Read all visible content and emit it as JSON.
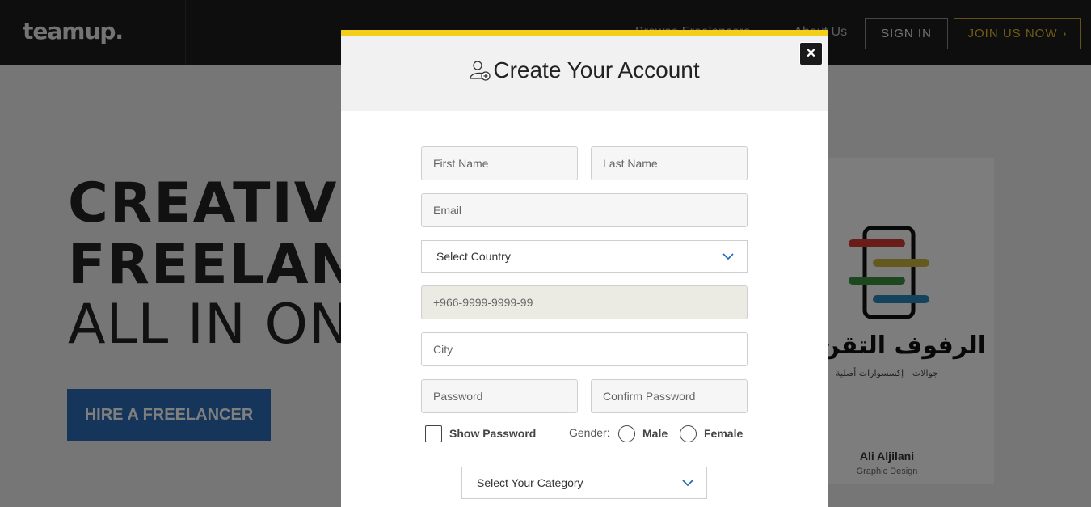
{
  "header": {
    "logo": "teamup.",
    "nav_link_1": "Browse Freelancers",
    "nav_link_2": "About Us",
    "signin_label": "SIGN IN",
    "join_label": "JOIN US NOW"
  },
  "hero": {
    "line1": "CREATIVE",
    "line2": "FREELANC",
    "line3": "ALL IN ON",
    "hire_button": "HIRE A FREELANCER"
  },
  "featured_card": {
    "arabic_title": "الرفوف التقن",
    "arabic_subtitle": "جوالات | إكسسوارات أصلية",
    "name": "Ali Aljilani",
    "role": "Graphic Design"
  },
  "modal": {
    "title": "Create Your Account",
    "close_label": "×",
    "first_name_placeholder": "First Name",
    "last_name_placeholder": "Last Name",
    "email_placeholder": "Email",
    "country_select": "Select Country",
    "phone_placeholder": "+966-9999-9999-99",
    "city_placeholder": "City",
    "password_placeholder": "Password",
    "confirm_password_placeholder": "Confirm Password",
    "show_password_label": "Show Password",
    "gender_label": "Gender:",
    "gender_male": "Male",
    "gender_female": "Female",
    "category_select": "Select Your Category"
  },
  "colors": {
    "accent_yellow": "#f3cf1a",
    "hire_blue": "#2a6bb5",
    "join_gold": "#e2b62b"
  }
}
